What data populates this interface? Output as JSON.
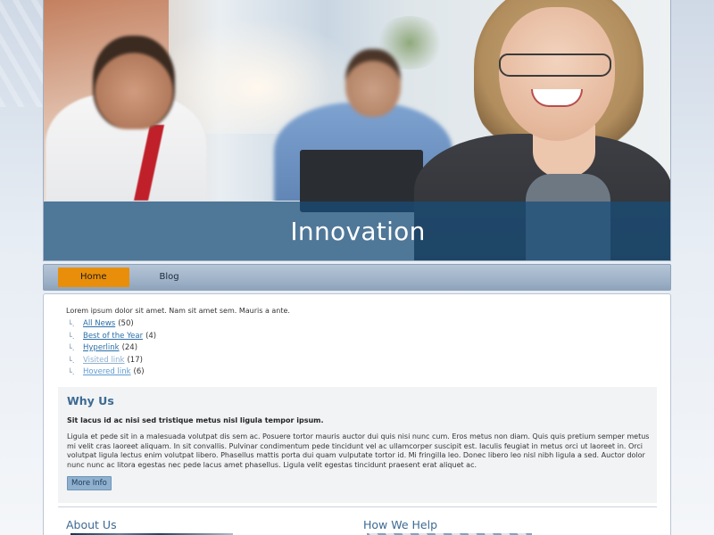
{
  "header": {
    "banner_title": "Innovation",
    "banner_color": "#184e7a"
  },
  "nav": {
    "items": [
      {
        "label": "Home",
        "active": true
      },
      {
        "label": "Blog",
        "active": false
      }
    ],
    "active_color": "#e98e0a"
  },
  "main": {
    "intro": "Lorem ipsum dolor sit amet. Nam sit amet sem. Mauris a ante.",
    "links": [
      {
        "label": "All News",
        "count": "(50)"
      },
      {
        "label": "Best of the Year",
        "count": "(4)"
      },
      {
        "label": "Hyperlink",
        "count": "(24)"
      },
      {
        "label": "Visited link",
        "count": "(17)"
      },
      {
        "label": "Hovered link",
        "count": "(6)"
      }
    ],
    "why": {
      "title": "Why Us",
      "bold": "Sit lacus id ac nisi sed tristique metus nisl ligula tempor ipsum.",
      "paragraph": "Ligula et pede sit in a malesuada volutpat dis sem ac. Posuere tortor mauris auctor dui quis nisi nunc cum. Eros metus non diam. Quis quis pretium semper metus mi velit cras laoreet aliquam. In sit convallis. Pulvinar condimentum pede tincidunt vel ac ullamcorper suscipit est. Iaculis feugiat in metus orci ut laoreet in. Orci volutpat ligula lectus enim volutpat libero. Phasellus mattis porta dui quam vulputate tortor id. Mi fringilla leo. Donec libero leo nisl nibh ligula a sed. Auctor dolor nunc nunc ac litora egestas nec pede lacus amet phasellus. Ligula velit egestas tincidunt praesent erat aliquet ac.",
      "button": "More Info"
    },
    "about_title": "About Us",
    "help_title": "How We Help"
  }
}
